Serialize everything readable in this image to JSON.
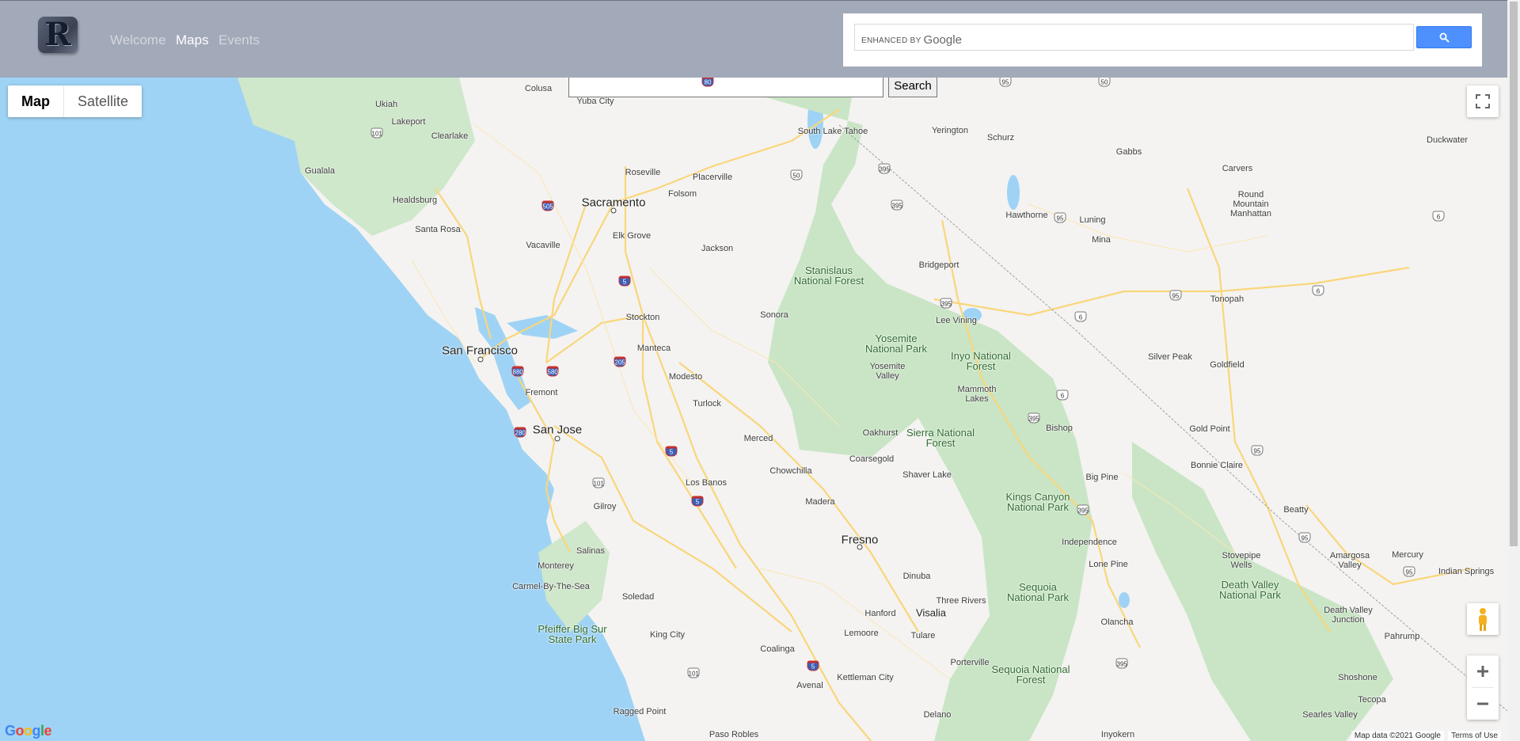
{
  "nav": {
    "logo_letter": "R",
    "links": [
      {
        "label": "Welcome",
        "active": false
      },
      {
        "label": "Maps",
        "active": true
      },
      {
        "label": "Events",
        "active": false
      }
    ]
  },
  "google_search": {
    "brand_text": "ENHANCED BY",
    "brand_name": "Google",
    "button_icon": "search-icon"
  },
  "map": {
    "type_options": [
      "Map",
      "Satellite"
    ],
    "selected_type": "Map",
    "search_placeholder": "",
    "search_button": "Search",
    "attribution": "Map data ©2021 Google",
    "terms": "Terms of Use",
    "logo": "Google",
    "colors": {
      "water": "#9fd3f5",
      "land": "#f4f3f1",
      "park": "#c9e5c5",
      "road": "#f9d67a"
    },
    "cities": [
      {
        "name": "San Francisco",
        "big": true
      },
      {
        "name": "San Jose",
        "big": true
      },
      {
        "name": "Sacramento",
        "big": true
      },
      {
        "name": "Fresno",
        "big": true
      },
      {
        "name": "Stockton"
      },
      {
        "name": "Modesto"
      },
      {
        "name": "Fremont"
      },
      {
        "name": "Santa Rosa"
      },
      {
        "name": "Vacaville"
      },
      {
        "name": "Roseville"
      },
      {
        "name": "Folsom"
      },
      {
        "name": "Elk Grove"
      },
      {
        "name": "Manteca"
      },
      {
        "name": "Turlock"
      },
      {
        "name": "Merced"
      },
      {
        "name": "Los Banos"
      },
      {
        "name": "Gilroy"
      },
      {
        "name": "Salinas"
      },
      {
        "name": "Monterey"
      },
      {
        "name": "Carmel-By-The-Sea"
      },
      {
        "name": "Soledad"
      },
      {
        "name": "King City"
      },
      {
        "name": "Hanford"
      },
      {
        "name": "Visalia"
      },
      {
        "name": "Tulare"
      },
      {
        "name": "Lemoore"
      },
      {
        "name": "Madera"
      },
      {
        "name": "Chowchilla"
      },
      {
        "name": "Coalinga"
      },
      {
        "name": "Avenal"
      },
      {
        "name": "Kettleman City"
      },
      {
        "name": "Porterville"
      },
      {
        "name": "Delano"
      },
      {
        "name": "Dinuba"
      },
      {
        "name": "Jackson"
      },
      {
        "name": "Sonora"
      },
      {
        "name": "Placerville"
      },
      {
        "name": "Yuba City"
      },
      {
        "name": "Colusa"
      },
      {
        "name": "Ukiah"
      },
      {
        "name": "Lakeport"
      },
      {
        "name": "Clearlake"
      },
      {
        "name": "Healdsburg"
      },
      {
        "name": "Gualala"
      },
      {
        "name": "South Lake Tahoe"
      },
      {
        "name": "Yerington"
      },
      {
        "name": "Schurz"
      },
      {
        "name": "Gabbs"
      },
      {
        "name": "Duckwater"
      },
      {
        "name": "Carvers"
      },
      {
        "name": "Round Mountain Manhattan"
      },
      {
        "name": "Hawthorne"
      },
      {
        "name": "Luning"
      },
      {
        "name": "Mina"
      },
      {
        "name": "Tonopah"
      },
      {
        "name": "Bridgeport"
      },
      {
        "name": "Lee Vining"
      },
      {
        "name": "Silver Peak"
      },
      {
        "name": "Goldfield"
      },
      {
        "name": "Mammoth Lakes"
      },
      {
        "name": "Bishop"
      },
      {
        "name": "Big Pine"
      },
      {
        "name": "Gold Point"
      },
      {
        "name": "Bonnie Claire"
      },
      {
        "name": "Beatty"
      },
      {
        "name": "Independence"
      },
      {
        "name": "Lone Pine"
      },
      {
        "name": "Olancha"
      },
      {
        "name": "Stovepipe Wells"
      },
      {
        "name": "Amargosa Valley"
      },
      {
        "name": "Mercury"
      },
      {
        "name": "Indian Springs"
      },
      {
        "name": "Death Valley Junction"
      },
      {
        "name": "Pahrump"
      },
      {
        "name": "Shoshone"
      },
      {
        "name": "Tecopa"
      },
      {
        "name": "Searles Valley"
      },
      {
        "name": "Inyokern"
      },
      {
        "name": "Oakhurst"
      },
      {
        "name": "Coarsegold"
      },
      {
        "name": "Shaver Lake"
      },
      {
        "name": "Three Rivers"
      },
      {
        "name": "Yosemite Valley"
      },
      {
        "name": "Ragged Point"
      },
      {
        "name": "Paso Robles"
      }
    ],
    "parks": [
      "Stanislaus National Forest",
      "Yosemite National Park",
      "Inyo National Forest",
      "Sierra National Forest",
      "Kings Canyon National Park",
      "Sequoia National Park",
      "Sequoia National Forest",
      "Death Valley National Park",
      "Pfeiffer Big Sur State Park"
    ],
    "shields": [
      {
        "label": "505",
        "type": "i"
      },
      {
        "label": "5",
        "type": "i"
      },
      {
        "label": "880",
        "type": "i"
      },
      {
        "label": "580",
        "type": "i"
      },
      {
        "label": "205",
        "type": "i"
      },
      {
        "label": "280",
        "type": "i"
      },
      {
        "label": "80",
        "type": "i"
      },
      {
        "label": "101",
        "type": "us"
      },
      {
        "label": "50",
        "type": "us"
      },
      {
        "label": "395",
        "type": "us"
      },
      {
        "label": "95",
        "type": "us"
      },
      {
        "label": "6",
        "type": "us"
      }
    ]
  }
}
